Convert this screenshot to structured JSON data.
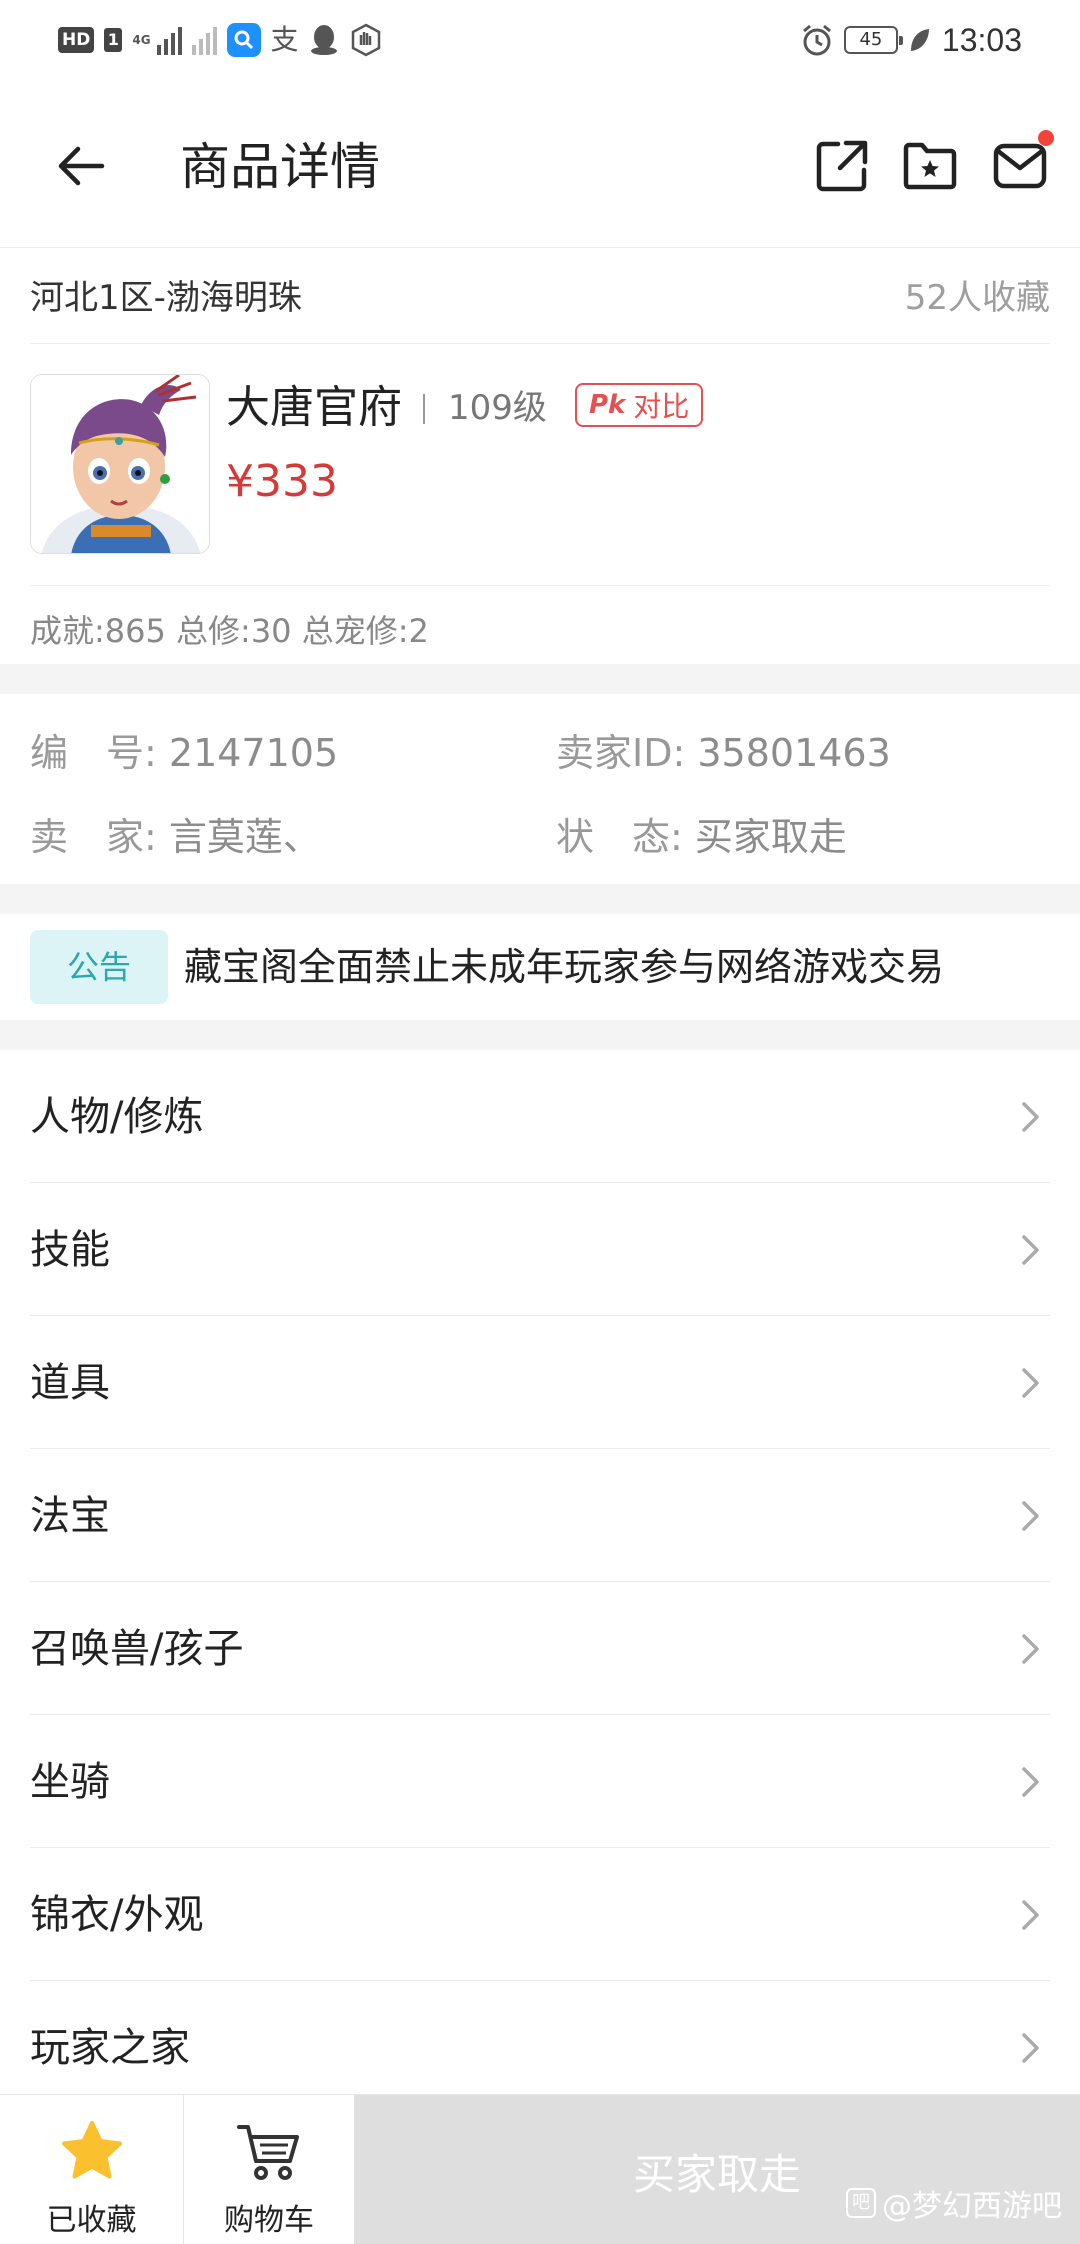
{
  "status_bar": {
    "hd": "HD",
    "sim": "1",
    "network": "4G",
    "battery": "45",
    "time": "13:03"
  },
  "header": {
    "title": "商品详情",
    "icons": [
      "back-arrow-icon",
      "share-icon",
      "favorite-folder-icon",
      "message-icon"
    ]
  },
  "server": {
    "name": "河北1区-渤海明珠",
    "favorites": "52人收藏"
  },
  "role": {
    "school": "大唐官府",
    "level": "109级",
    "pk_mark": "Pk",
    "pk_label": "对比",
    "price": "¥333",
    "stats": "成就:865 总修:30 总宠修:2"
  },
  "info": {
    "id_label": "编　号:",
    "id_value": "2147105",
    "seller_id_label": "卖家ID:",
    "seller_id_value": "35801463",
    "seller_label": "卖　家:",
    "seller_value": "言莫莲、",
    "status_label": "状　态:",
    "status_value": "买家取走"
  },
  "notice": {
    "tag": "公告",
    "text": "藏宝阁全面禁止未成年玩家参与网络游戏交易"
  },
  "menu": [
    {
      "label": "人物/修炼"
    },
    {
      "label": "技能"
    },
    {
      "label": "道具"
    },
    {
      "label": "法宝"
    },
    {
      "label": "召唤兽/孩子"
    },
    {
      "label": "坐骑"
    },
    {
      "label": "锦衣/外观"
    },
    {
      "label": "玩家之家"
    }
  ],
  "bottom": {
    "fav_label": "已收藏",
    "cart_label": "购物车",
    "buy_label": "买家取走",
    "watermark": "@梦幻西游吧"
  },
  "colors": {
    "price": "#d33a3a",
    "pk": "#e35151",
    "notice_tag_bg": "#dcf4f5",
    "notice_tag_text": "#2aa7b0",
    "star": "#fbc02d",
    "disabled_button": "#dedede"
  }
}
